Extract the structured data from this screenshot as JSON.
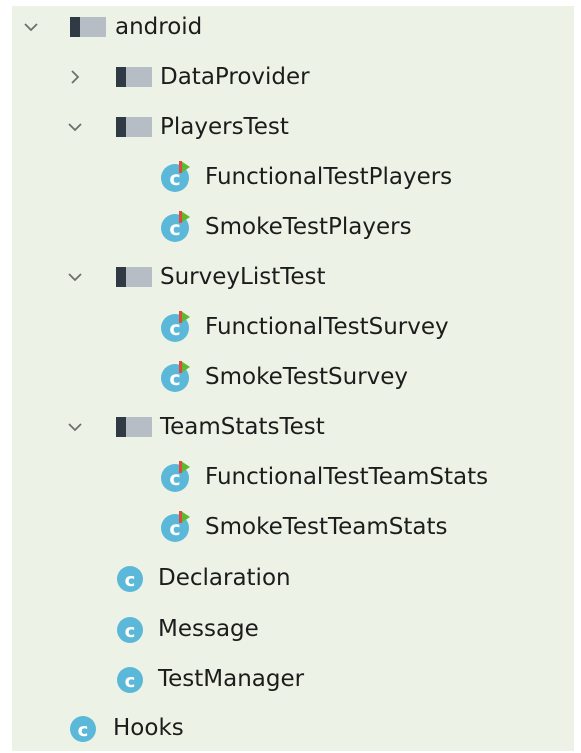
{
  "colors": {
    "panel_bg": "#ecf3e6",
    "folder": "#b6bdc5",
    "class_circle": "#5bb8d8",
    "test_marker_red": "#e5493a",
    "test_marker_green": "#5fb832",
    "chevron": "#6e6e6e"
  },
  "tree": {
    "root": {
      "label": "android",
      "icon": "folder-icon",
      "state": "expanded"
    },
    "data_provider": {
      "label": "DataProvider",
      "icon": "folder-icon",
      "state": "collapsed"
    },
    "players_test": {
      "label": "PlayersTest",
      "icon": "folder-icon",
      "state": "expanded"
    },
    "functional_test_players": {
      "label": "FunctionalTestPlayers",
      "icon": "test-class-icon"
    },
    "smoke_test_players": {
      "label": "SmokeTestPlayers",
      "icon": "test-class-icon"
    },
    "survey_list_test": {
      "label": "SurveyListTest",
      "icon": "folder-icon",
      "state": "expanded"
    },
    "functional_test_survey": {
      "label": "FunctionalTestSurvey",
      "icon": "test-class-icon"
    },
    "smoke_test_survey": {
      "label": "SmokeTestSurvey",
      "icon": "test-class-icon"
    },
    "team_stats_test": {
      "label": "TeamStatsTest",
      "icon": "folder-icon",
      "state": "expanded"
    },
    "functional_test_team_stats": {
      "label": "FunctionalTestTeamStats",
      "icon": "test-class-icon"
    },
    "smoke_test_team_stats": {
      "label": "SmokeTestTeamStats",
      "icon": "test-class-icon"
    },
    "declaration": {
      "label": "Declaration",
      "icon": "class-icon"
    },
    "message": {
      "label": "Message",
      "icon": "class-icon"
    },
    "test_manager": {
      "label": "TestManager",
      "icon": "class-icon"
    },
    "hooks": {
      "label": "Hooks",
      "icon": "class-icon"
    },
    "class_letter": "c"
  }
}
